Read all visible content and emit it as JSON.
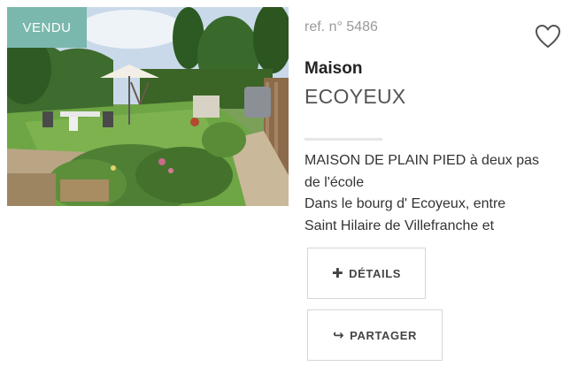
{
  "listing": {
    "status_badge": "VENDU",
    "reference": "ref. n° 5486",
    "type": "Maison",
    "city": "ECOYEUX",
    "description_lines": [
      "MAISON DE PLAIN PIED à deux pas",
      "de l'école",
      "Dans le bourg d' Ecoyeux, entre",
      "Saint Hilaire de Villefranche et"
    ]
  },
  "buttons": {
    "details_label": "DÉTAILS",
    "details_icon": "plus-icon",
    "share_label": "PARTAGER",
    "share_icon": "share-arrow-icon"
  },
  "icons": {
    "favorite": "heart-outline-icon"
  },
  "colors": {
    "badge_bg": "#7ab8ad",
    "text_muted": "#9a9a9a",
    "border": "#d6d6d6"
  }
}
